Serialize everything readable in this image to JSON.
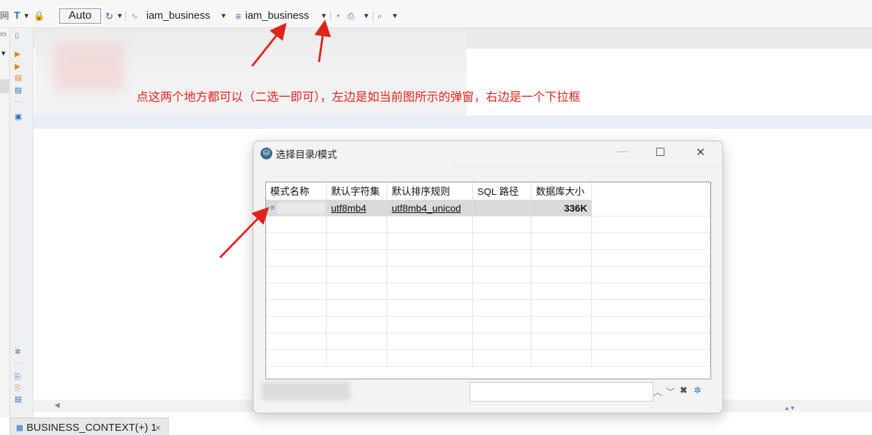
{
  "toolbar": {
    "auto_label": "Auto",
    "connection_name": "iam_business",
    "schema_name": "iam_business"
  },
  "annotation": {
    "text": "点这两个地方都可以（二选一即可），左边是如当前图所示的弹窗，右边是一个下拉框",
    "color": "#e0231b"
  },
  "dialog": {
    "title": "选择目录/模式",
    "columns": [
      "模式名称",
      "默认字符集",
      "默认排序规则",
      "SQL 路径",
      "数据库大小"
    ],
    "rows": [
      {
        "name": "",
        "charset": "utf8mb4",
        "collation": "utf8mb4_unicod",
        "sql_path": "",
        "size": "336K"
      }
    ],
    "minimize_label": "—",
    "maximize_label": "☐",
    "close_label": "✕"
  },
  "bottom_tab": {
    "label": "BUSINESS_CONTEXT(+) 1",
    "close_label": "×"
  },
  "colors": {
    "accent_blue": "#2c6dc5",
    "arrow_red": "#e0231b",
    "selection_gray": "#d9d9d9"
  },
  "icons": [
    "text-format-icon",
    "lock-icon",
    "history-icon",
    "connection-icon",
    "database-icon",
    "dashboard-icon",
    "print-icon",
    "search-icon",
    "settings-icon",
    "close-icon"
  ]
}
